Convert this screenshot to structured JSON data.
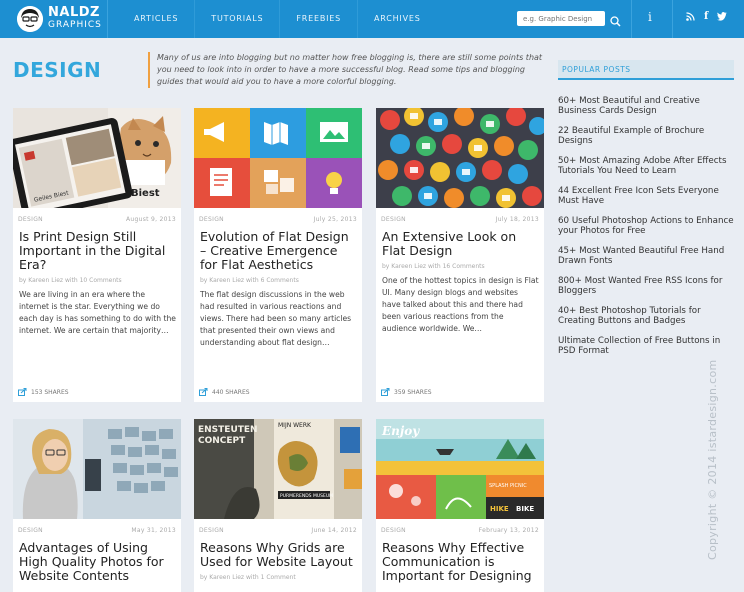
{
  "header": {
    "logo_main": "NALDZ",
    "logo_sub": "GRAPHICS",
    "nav": [
      "ARTICLES",
      "TUTORIALS",
      "FREEBIES",
      "ARCHIVES"
    ],
    "search_placeholder": "e.g. Graphic Design",
    "brand_color": "#1d8fd1"
  },
  "page": {
    "title": "DESIGN",
    "intro": "Many of us are into blogging but no matter how free blogging is, there are still some points that you need to look into in order to have a more successful blog. Read some tips and blogging guides that would aid you to have a more colorful blogging."
  },
  "cards": [
    {
      "category": "DESIGN",
      "date": "August 9, 2013",
      "title": "Is Print Design Still Important in the Digital Era?",
      "byline": "by Kareen Liez with 10 Comments",
      "excerpt": "We are living in an era where the internet is the star. Everything we do each day is has something to do with the internet. We are certain that majority…",
      "shares": "153 SHARES",
      "thumb_text": [
        "Geiles Biest",
        "Biest"
      ]
    },
    {
      "category": "DESIGN",
      "date": "July 25, 2013",
      "title": "Evolution of Flat Design – Creative Emergence for Flat Aesthetics",
      "byline": "by Kareen Liez with 6 Comments",
      "excerpt": "The flat design discussions in the web had resulted in various reactions and views. There had been so many articles that presented their own views and understanding about flat design…",
      "shares": "440 SHARES"
    },
    {
      "category": "DESIGN",
      "date": "July 18, 2013",
      "title": "An Extensive Look on Flat Design",
      "byline": "by Kareen Liez with 16 Comments",
      "excerpt": "One of the hottest topics in design is Flat UI. Many design blogs and websites have talked about this and there had been various reactions from the audience worldwide. We…",
      "shares": "359 SHARES"
    },
    {
      "category": "DESIGN",
      "date": "May 31, 2013",
      "title": "Advantages of Using High Quality Photos for Website Contents"
    },
    {
      "category": "DESIGN",
      "date": "June 14, 2012",
      "title": "Reasons Why Grids are Used for Website Layout",
      "byline": "by Kareen Liez with 1 Comment",
      "thumb_text": [
        "ENSTEUTEN",
        "CONCEPT",
        "MIJN WERK",
        "PURMERENDS MUSEUM"
      ]
    },
    {
      "category": "DESIGN",
      "date": "February 13, 2012",
      "title": "Reasons Why Effective Communication is Important for Designing",
      "thumb_text": [
        "Enjoy",
        "SPLASH PICNIC",
        "HIKE",
        "BIKE"
      ]
    }
  ],
  "sidebar": {
    "heading": "POPULAR POSTS",
    "items": [
      "60+ Most Beautiful and Creative Business Cards Design",
      "22 Beautiful Example of Brochure Designs",
      "50+ Most Amazing Adobe After Effects Tutorials You Need to Learn",
      "44 Excellent Free Icon Sets Everyone Must Have",
      "60 Useful Photoshop Actions to Enhance your Photos for Free",
      "45+ Most Wanted Beautiful Free Hand Drawn Fonts",
      "800+ Most Wanted Free RSS Icons for Bloggers",
      "40+ Best Photoshop Tutorials for Creating Buttons and Badges",
      "Ultimate Collection of Free Buttons in PSD Format"
    ]
  },
  "footer": {
    "copyright": "Copyright © 2014 istardesign.com"
  }
}
